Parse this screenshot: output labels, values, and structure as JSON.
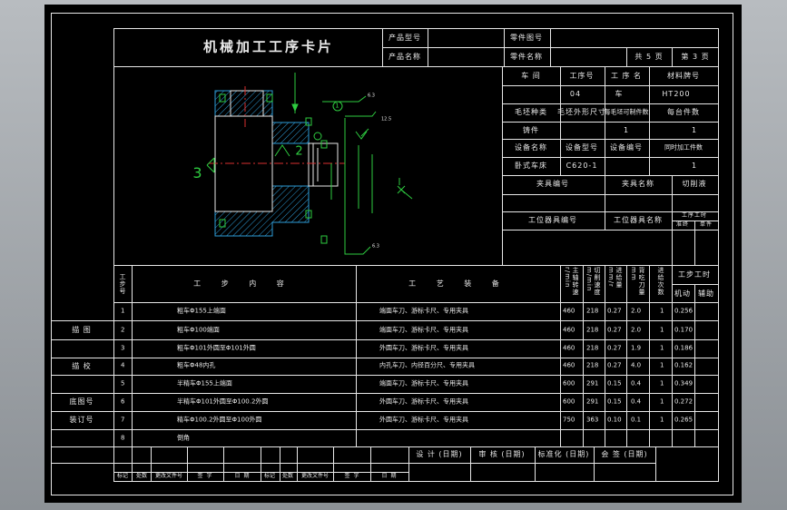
{
  "header": {
    "title": "机械加工工序卡片",
    "product_model_label": "产品型号",
    "product_name_label": "产品名称",
    "part_number_label": "零件图号",
    "part_name_label": "零件名称",
    "total_pages": "共 5 页",
    "page_no": "第 3 页"
  },
  "info": {
    "workshop_label": "车 间",
    "process_no_label": "工序号",
    "process_name_label": "工 序 名",
    "material_label": "材料牌号",
    "process_no": "04",
    "process_name": "车",
    "material": "HT200",
    "blank_type_label": "毛坯种类",
    "blank_size_label": "毛坯外形尺寸",
    "blank_pieces_label": "每毛坯可制件数",
    "pieces_per_unit_label": "每台件数",
    "blank_type": "铸件",
    "blank_pieces": "1",
    "pieces_per_unit": "1",
    "equipment_name_label": "设备名称",
    "equipment_model_label": "设备型号",
    "equipment_no_label": "设备编号",
    "simultaneous_label": "同时加工件数",
    "equipment_name": "卧式车床",
    "equipment_model": "C620-1",
    "simultaneous": "1",
    "fixture_no_label": "夹具编号",
    "fixture_name_label": "夹具名称",
    "coolant_label": "切削液",
    "station_tool_no_label": "工位器具编号",
    "station_tool_name_label": "工位器具名称",
    "hours_label": "工序工时",
    "hours_prep_label": "准终",
    "hours_unit_label": "单件"
  },
  "drawing": {
    "label_3": "3",
    "label_2": "2",
    "label_1": "1",
    "rough_a": "6.3",
    "rough_b": "12.5",
    "rough_c": "6.3"
  },
  "table": {
    "col_step_no": "工步号",
    "col_content": "工 步 内 容",
    "col_equipment": "工 艺 装 备",
    "col_speed": "主轴转速 r/min",
    "col_cut_speed": "切削速度 m/min",
    "col_feed": "进给量 mm/r",
    "col_depth": "背吃刀量 mm",
    "col_passes": "进给次数",
    "col_hours": "工步工时",
    "col_machine": "机动",
    "col_aux": "辅助",
    "rows": [
      {
        "no": "1",
        "content": "粗车Φ155上端面",
        "equip": "端面车刀、游标卡尺、专用夹具",
        "speed": "460",
        "v": "218",
        "f": "0.27",
        "ap": "2.0",
        "n": "1",
        "t": "0.256"
      },
      {
        "no": "2",
        "content": "粗车Φ100端面",
        "equip": "端面车刀、游标卡尺、专用夹具",
        "speed": "460",
        "v": "218",
        "f": "0.27",
        "ap": "2.0",
        "n": "1",
        "t": "0.170"
      },
      {
        "no": "3",
        "content": "粗车Φ101外圆至Φ101外圆",
        "equip": "外圆车刀、游标卡尺、专用夹具",
        "speed": "460",
        "v": "218",
        "f": "0.27",
        "ap": "1.9",
        "n": "1",
        "t": "0.186"
      },
      {
        "no": "4",
        "content": "粗车Φ48内孔",
        "equip": "内孔车刀、内径百分尺、专用夹具",
        "speed": "460",
        "v": "218",
        "f": "0.27",
        "ap": "4.0",
        "n": "1",
        "t": "0.162"
      },
      {
        "no": "5",
        "content": "半精车Φ155上端面",
        "equip": "端面车刀、游标卡尺、专用夹具",
        "speed": "600",
        "v": "291",
        "f": "0.15",
        "ap": "0.4",
        "n": "1",
        "t": "0.349"
      },
      {
        "no": "6",
        "content": "半精车Φ101外圆至Φ100.2外圆",
        "equip": "外圆车刀、游标卡尺、专用夹具",
        "speed": "600",
        "v": "291",
        "f": "0.15",
        "ap": "0.4",
        "n": "1",
        "t": "0.272"
      },
      {
        "no": "7",
        "content": "精车Φ100.2外圆至Φ100外圆",
        "equip": "外圆车刀、游标卡尺、专用夹具",
        "speed": "750",
        "v": "363",
        "f": "0.10",
        "ap": "0.1",
        "n": "1",
        "t": "0.265"
      },
      {
        "no": "8",
        "content": "倒角",
        "equip": "",
        "speed": "",
        "v": "",
        "f": "",
        "ap": "",
        "n": "",
        "t": ""
      }
    ]
  },
  "side": {
    "desc_label": "描 图",
    "check_label": "描 校",
    "drawing_no_label": "底图号",
    "binding_no_label": "装订号"
  },
  "footer": {
    "design_label": "设 计 (日期)",
    "review_label": "审 核 (日期)",
    "standard_label": "标准化 (日期)",
    "sign_label": "会 签 (日期)",
    "mark_label": "标记",
    "count_label": "处数",
    "file_label": "更改文件号",
    "signature_label": "签 字",
    "date_label": "日 期",
    "mark_label_2": "标记",
    "count_label_2": "处数",
    "file_label_2": "更改文件号",
    "signature_label_2": "签 字",
    "date_label_2": "日 期"
  }
}
